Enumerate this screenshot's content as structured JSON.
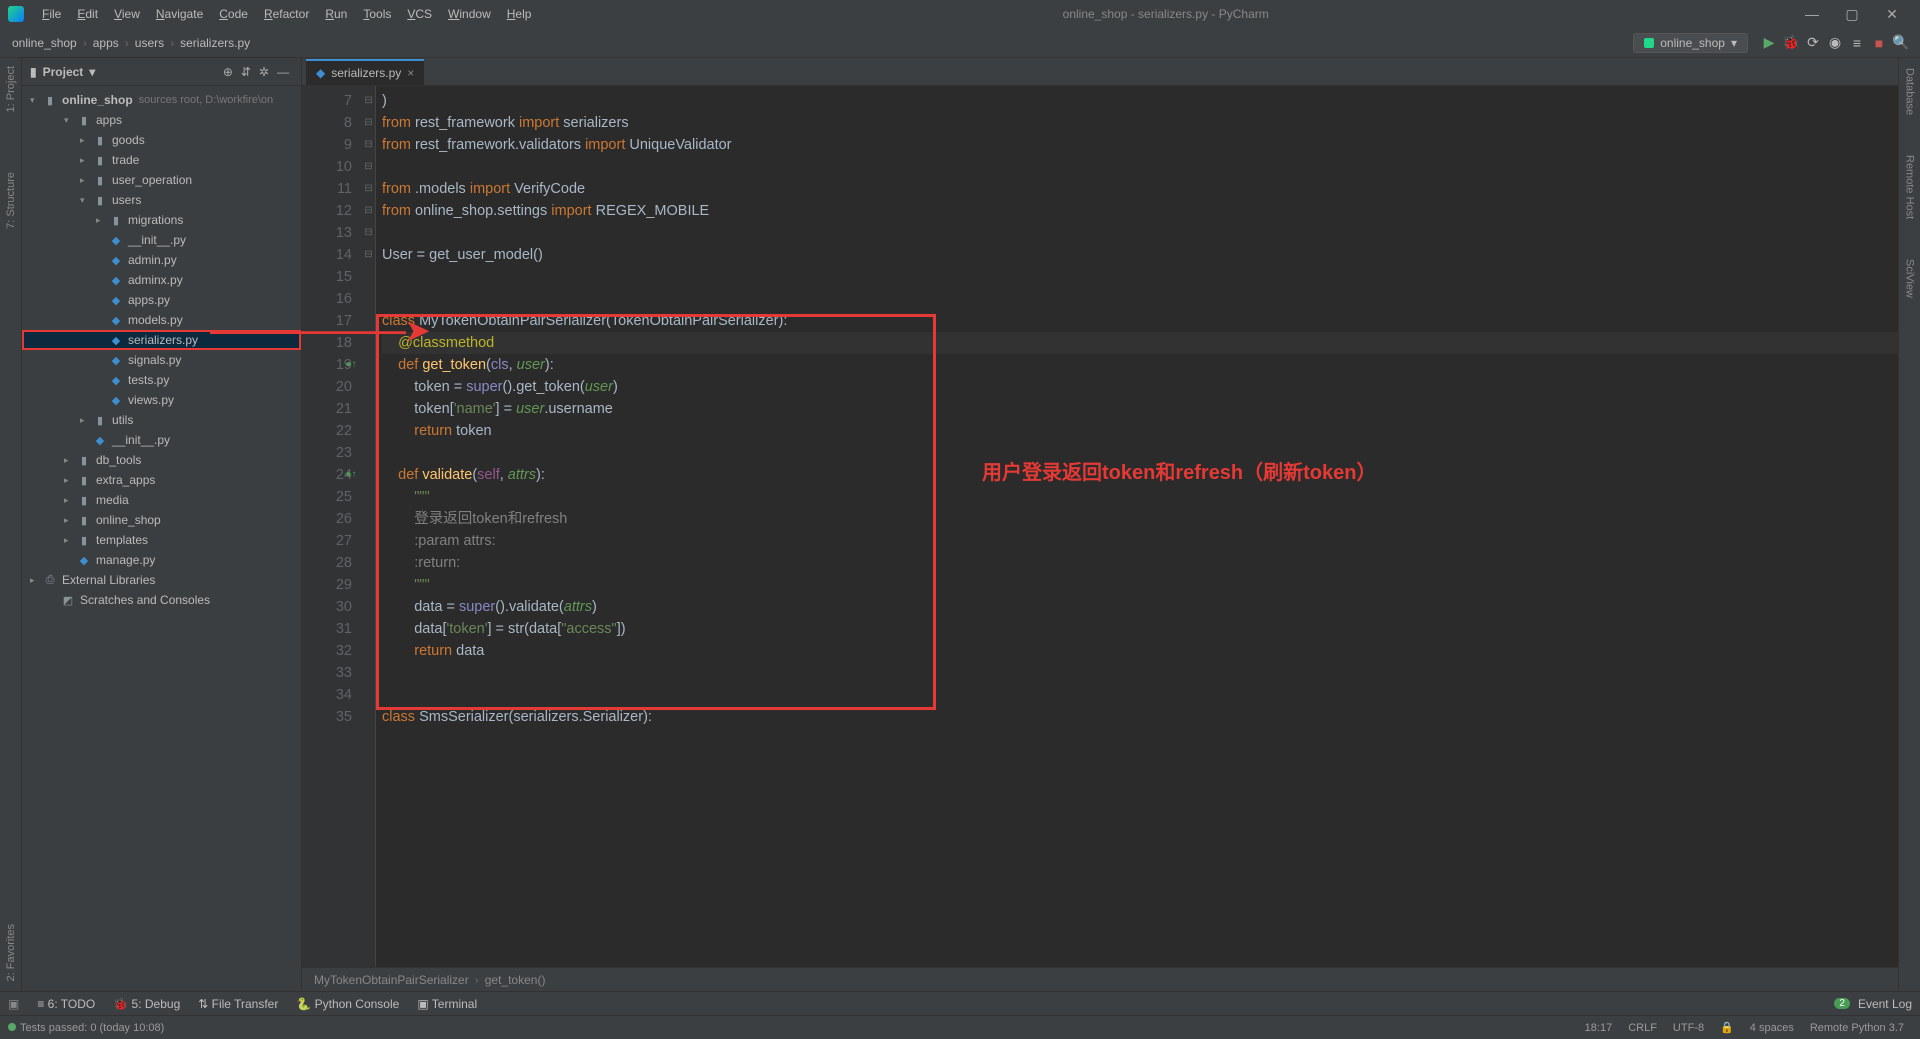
{
  "window": {
    "title": "online_shop - serializers.py - PyCharm"
  },
  "menu": [
    "File",
    "Edit",
    "View",
    "Navigate",
    "Code",
    "Refactor",
    "Run",
    "Tools",
    "VCS",
    "Window",
    "Help"
  ],
  "breadcrumbs": [
    "online_shop",
    "apps",
    "users",
    "serializers.py"
  ],
  "run_config": {
    "name": "online_shop"
  },
  "project": {
    "title": "Project",
    "root": {
      "name": "online_shop",
      "hint": "sources root,  D:\\workfire\\on"
    },
    "tree": [
      {
        "d": 1,
        "t": "folder",
        "open": true,
        "name": "apps"
      },
      {
        "d": 2,
        "t": "folder",
        "open": false,
        "name": "goods"
      },
      {
        "d": 2,
        "t": "folder",
        "open": false,
        "name": "trade"
      },
      {
        "d": 2,
        "t": "folder",
        "open": false,
        "name": "user_operation"
      },
      {
        "d": 2,
        "t": "folder",
        "open": true,
        "name": "users"
      },
      {
        "d": 3,
        "t": "folder",
        "open": false,
        "name": "migrations"
      },
      {
        "d": 3,
        "t": "py",
        "name": "__init__.py"
      },
      {
        "d": 3,
        "t": "py",
        "name": "admin.py"
      },
      {
        "d": 3,
        "t": "py",
        "name": "adminx.py"
      },
      {
        "d": 3,
        "t": "py",
        "name": "apps.py"
      },
      {
        "d": 3,
        "t": "py",
        "name": "models.py"
      },
      {
        "d": 3,
        "t": "py",
        "name": "serializers.py",
        "sel": true
      },
      {
        "d": 3,
        "t": "py",
        "name": "signals.py"
      },
      {
        "d": 3,
        "t": "py",
        "name": "tests.py"
      },
      {
        "d": 3,
        "t": "py",
        "name": "views.py"
      },
      {
        "d": 2,
        "t": "folder",
        "open": false,
        "name": "utils"
      },
      {
        "d": 2,
        "t": "py",
        "name": "__init__.py"
      },
      {
        "d": 1,
        "t": "folder",
        "open": false,
        "name": "db_tools"
      },
      {
        "d": 1,
        "t": "folder",
        "open": false,
        "name": "extra_apps"
      },
      {
        "d": 1,
        "t": "folder",
        "open": false,
        "name": "media"
      },
      {
        "d": 1,
        "t": "folder",
        "open": false,
        "name": "online_shop"
      },
      {
        "d": 1,
        "t": "folder",
        "open": false,
        "name": "templates"
      },
      {
        "d": 1,
        "t": "py",
        "name": "manage.py"
      },
      {
        "d": 0,
        "t": "lib",
        "name": "External Libraries"
      },
      {
        "d": 0,
        "t": "scratch",
        "name": "Scratches and Consoles"
      }
    ]
  },
  "editor": {
    "tab": "serializers.py",
    "breadcrumb": [
      "MyTokenObtainPairSerializer",
      "get_token()"
    ],
    "annotation": "用户登录返回token和refresh（刷新token）",
    "lines": [
      {
        "n": 7,
        "html": ")"
      },
      {
        "n": 8,
        "html": "<span class='kw'>from</span> rest_framework <span class='kw'>import</span> serializers"
      },
      {
        "n": 9,
        "html": "<span class='kw'>from</span> rest_framework.validators <span class='kw'>import</span> UniqueValidator"
      },
      {
        "n": 10,
        "html": ""
      },
      {
        "n": 11,
        "html": "<span class='kw'>from</span> .models <span class='kw'>import</span> VerifyCode"
      },
      {
        "n": 12,
        "html": "<span class='kw'>from</span> online_shop.settings <span class='kw'>import</span> REGEX_MOBILE"
      },
      {
        "n": 13,
        "html": ""
      },
      {
        "n": 14,
        "html": "User = get_user_model()"
      },
      {
        "n": 15,
        "html": ""
      },
      {
        "n": 16,
        "html": ""
      },
      {
        "n": 17,
        "html": "<span class='kw'>class</span> <span class='cls'>MyTokenObtainPairSerializer</span>(TokenObtainPairSerializer):"
      },
      {
        "n": 18,
        "html": "    <span class='deco'>@classmethod</span>",
        "hl": true
      },
      {
        "n": 19,
        "html": "    <span class='kw'>def</span> <span class='fn'>get_token</span>(<span class='builtin'>cls</span>, <span class='param'>user</span>):",
        "marker": "go"
      },
      {
        "n": 20,
        "html": "        token = <span class='builtin'>super</span>().get_token(<span class='param'>user</span>)"
      },
      {
        "n": 21,
        "html": "        token[<span class='str'>'name'</span>] = <span class='param'>user</span>.username"
      },
      {
        "n": 22,
        "html": "        <span class='kw'>return</span> token"
      },
      {
        "n": 23,
        "html": ""
      },
      {
        "n": 24,
        "html": "    <span class='kw'>def</span> <span class='fn'>validate</span>(<span class='self'>self</span>, <span class='param'>attrs</span>):",
        "marker": "go"
      },
      {
        "n": 25,
        "html": "        <span class='str'>\"\"\"</span>"
      },
      {
        "n": 26,
        "html": "        <span class='comment'>登录返回token和refresh</span>"
      },
      {
        "n": 27,
        "html": "        <span class='comment'>:param attrs:</span>"
      },
      {
        "n": 28,
        "html": "        <span class='comment'>:return:</span>"
      },
      {
        "n": 29,
        "html": "        <span class='str'>\"\"\"</span>"
      },
      {
        "n": 30,
        "html": "        data = <span class='builtin'>super</span>().validate(<span class='param'>attrs</span>)"
      },
      {
        "n": 31,
        "html": "        data[<span class='str'>'token'</span>] = str(data[<span class='str'>\"access\"</span>])"
      },
      {
        "n": 32,
        "html": "        <span class='kw'>return</span> data"
      },
      {
        "n": 33,
        "html": ""
      },
      {
        "n": 34,
        "html": ""
      },
      {
        "n": 35,
        "html": "<span class='kw'>class</span> <span class='cls'>SmsSerializer</span>(serializers.Serializer):"
      }
    ]
  },
  "bottom_tools": [
    "≡ 6: TODO",
    "🐞 5: Debug",
    "⇅ File Transfer",
    "🐍 Python Console",
    "▣ Terminal"
  ],
  "status": {
    "tests": "Tests passed: 0 (today 10:08)",
    "time": "18:17",
    "sep": "CRLF",
    "enc": "UTF-8",
    "indent": "4 spaces",
    "interp": "Remote Python 3.7",
    "event": "Event Log"
  },
  "left_tabs": [
    "1: Project",
    "7: Structure",
    "2: Favorites"
  ],
  "right_tabs": [
    "Database",
    "Remote Host",
    "SciView"
  ]
}
